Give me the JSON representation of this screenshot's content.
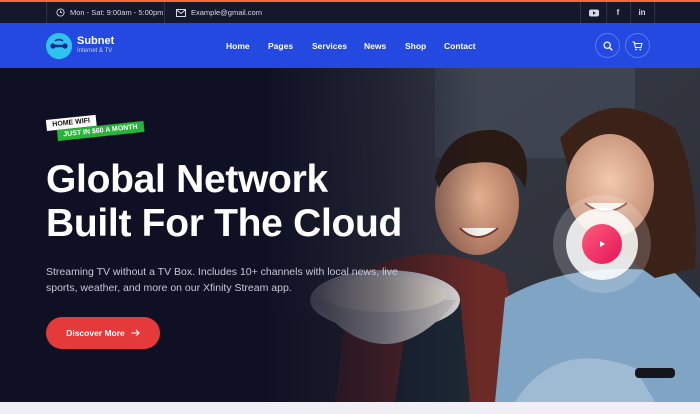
{
  "topbar": {
    "hours": "Mon - Sat: 9:00am - 5:00pm",
    "email": "Example@gmail.com",
    "social": [
      "youtube-icon",
      "facebook-icon",
      "linkedin-icon"
    ],
    "social_labels": {
      "facebook": "f",
      "linkedin": "in"
    }
  },
  "header": {
    "brand_name": "Subnet",
    "brand_tagline": "Internet & TV",
    "nav": [
      "Home",
      "Pages",
      "Services",
      "News",
      "Shop",
      "Contact"
    ],
    "icons": [
      "search-icon",
      "cart-icon"
    ]
  },
  "hero": {
    "badge_primary": "HOME WIFI",
    "badge_secondary": "JUST IN $60 A MONTH",
    "headline_line1": "Global Network",
    "headline_line2": "Built For The Cloud",
    "description": "Streaming TV without a TV Box. Includes 10+ channels with local news, live sports, weather, and more on our Xfinity Stream app.",
    "cta_label": "Discover More",
    "play_icon": "play-icon"
  },
  "colors": {
    "topbar_bg": "#15172a",
    "header_bg": "#2449e0",
    "hero_bg": "#0f1024",
    "cta": "#e43a3a",
    "badge_green": "#27b43a",
    "play": "#ff4f78",
    "accent_line": "#f26b3a"
  }
}
